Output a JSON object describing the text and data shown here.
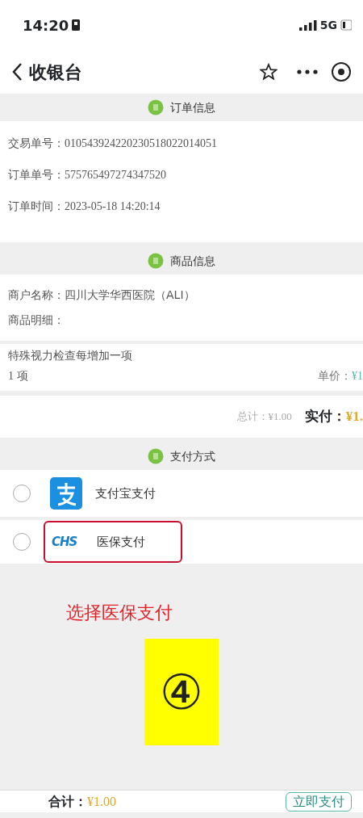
{
  "status_bar": {
    "time": "14:20",
    "network": "5G"
  },
  "nav": {
    "title": "收银台"
  },
  "order_section": {
    "title": "订单信息",
    "rows": [
      {
        "label": "交易单号：",
        "value": "010543924220230518022014051"
      },
      {
        "label": "订单单号：",
        "value": "575765497274347520"
      },
      {
        "label": "订单时间：",
        "value": "2023-05-18 14:20:14"
      }
    ]
  },
  "goods_section": {
    "title": "商品信息",
    "merchant_label": "商户名称：",
    "merchant": "四川大学华西医院（ALI）",
    "detail_label": "商品明细：",
    "item": {
      "name": "特殊视力检查每增加一项",
      "quantity": "1 项",
      "price_label": "单价：",
      "price": "¥1"
    },
    "total_label": "总计：",
    "total": "¥1.00",
    "paid_label": "实付：",
    "paid": "¥1."
  },
  "payment_section": {
    "title": "支付方式",
    "methods": [
      {
        "kind": "alipay",
        "label": "支付宝支付",
        "selected": false,
        "highlighted": false
      },
      {
        "kind": "chs",
        "label": "医保支付",
        "logo": "CHS",
        "selected": false,
        "highlighted": true
      }
    ]
  },
  "annotation": {
    "caption": "选择医保支付",
    "step": "④"
  },
  "bottom_bar": {
    "sum_label": "合计：",
    "sum": "¥1.00",
    "pay_button": "立即支付"
  }
}
